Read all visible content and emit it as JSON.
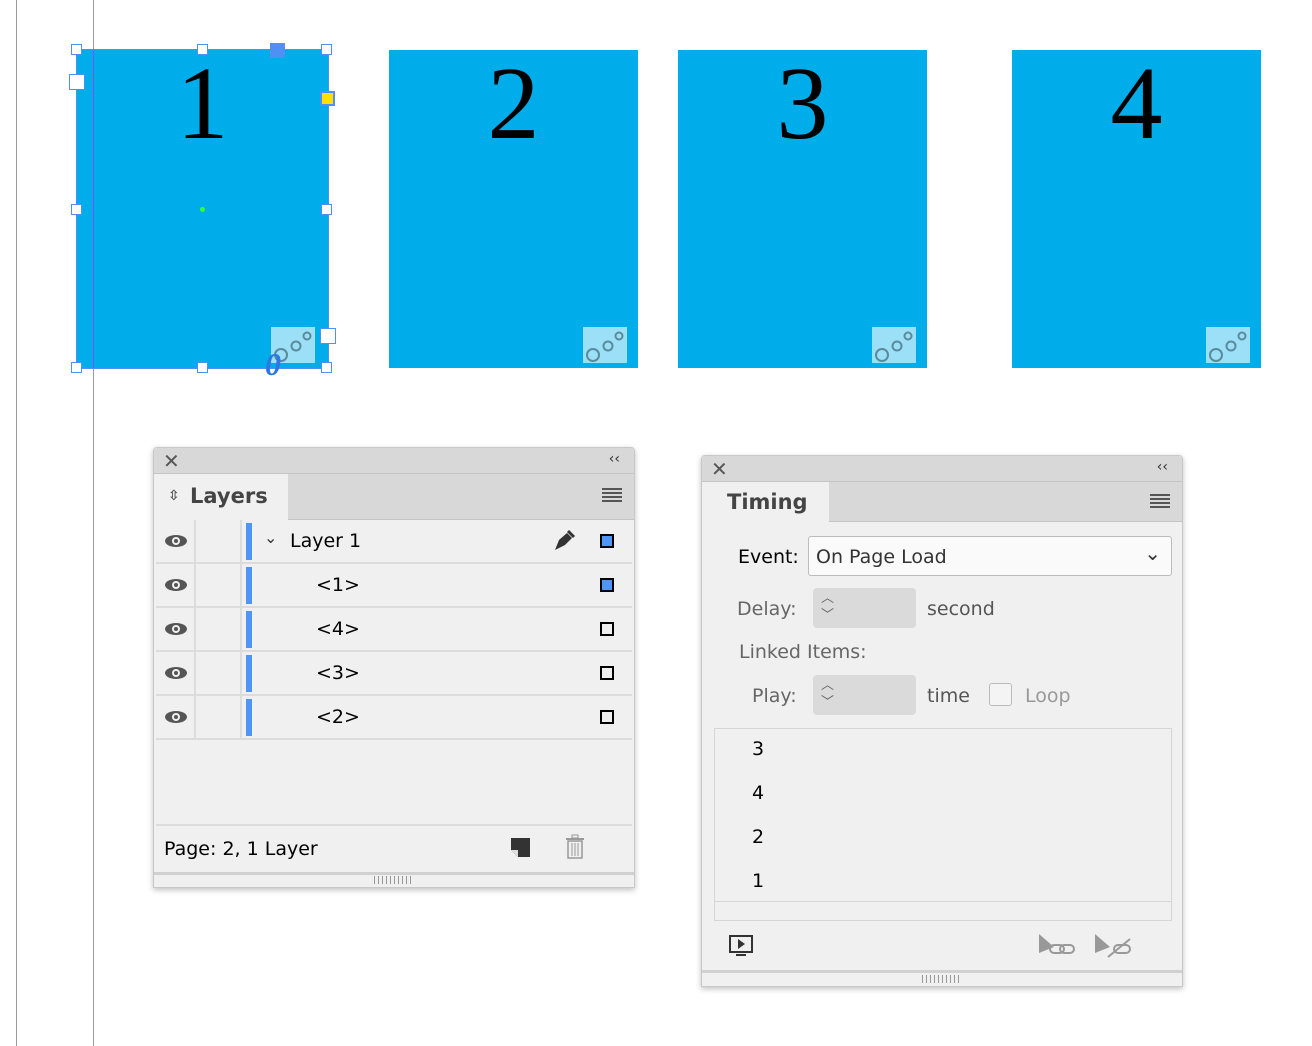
{
  "canvas": {
    "pages": [
      {
        "label": "1",
        "selected": true,
        "animation_badge": "0"
      },
      {
        "label": "2"
      },
      {
        "label": "3"
      },
      {
        "label": "4"
      }
    ],
    "page_color": "#00adeb",
    "selection_color": "#4f90f5"
  },
  "layers_panel": {
    "tab_label": "Layers",
    "layer": {
      "name": "Layer 1",
      "expanded": true,
      "color": "#4f95f6"
    },
    "items": [
      {
        "name": "<1>",
        "selected": true
      },
      {
        "name": "<4>",
        "selected": false
      },
      {
        "name": "<3>",
        "selected": false
      },
      {
        "name": "<2>",
        "selected": false
      }
    ],
    "status": "Page: 2, 1 Layer"
  },
  "timing_panel": {
    "tab_label": "Timing",
    "event_label": "Event:",
    "event_value": "On Page Load",
    "delay_label": "Delay:",
    "delay_value": "",
    "delay_unit": "second",
    "linked_items_label": "Linked Items:",
    "play_label": "Play:",
    "play_value": "",
    "play_unit": "time",
    "loop_label": "Loop",
    "loop_checked": false,
    "items": [
      "3",
      "4",
      "2",
      "1"
    ]
  }
}
